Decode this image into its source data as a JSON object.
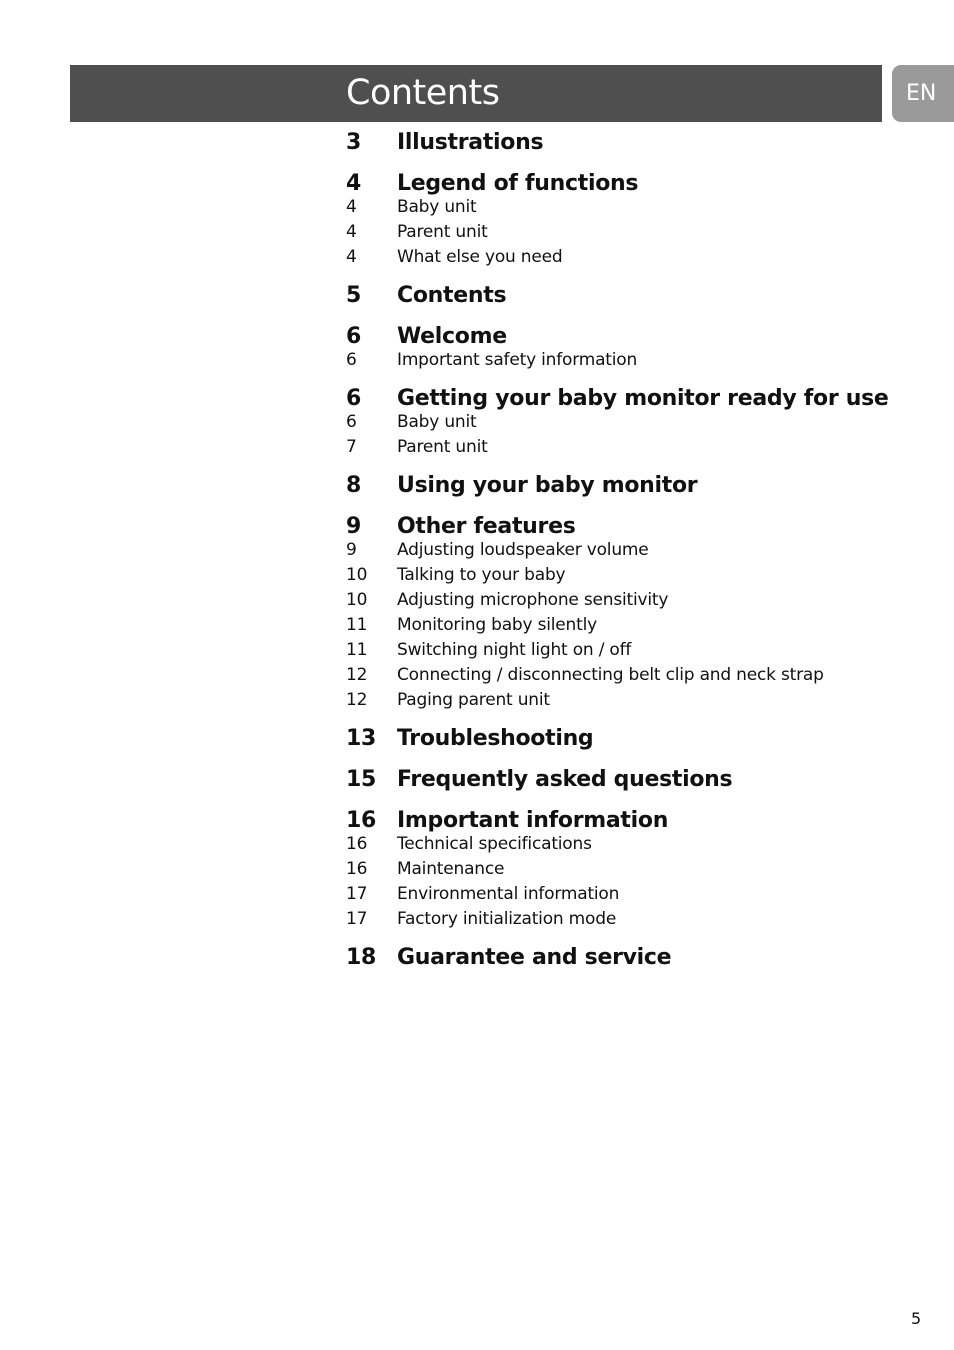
{
  "header": {
    "title": "Contents",
    "language_tab": "EN"
  },
  "colors": {
    "header_bar": "#4f4f4f",
    "language_tab": "#9a9a9a",
    "text": "#111111"
  },
  "toc": [
    {
      "page": "3",
      "title": "Illustrations",
      "subs": []
    },
    {
      "page": "4",
      "title": "Legend of functions",
      "subs": [
        {
          "page": "4",
          "title": "Baby unit"
        },
        {
          "page": "4",
          "title": "Parent unit"
        },
        {
          "page": "4",
          "title": "What else you need"
        }
      ]
    },
    {
      "page": "5",
      "title": "Contents",
      "subs": []
    },
    {
      "page": "6",
      "title": "Welcome",
      "subs": [
        {
          "page": "6",
          "title": "Important safety information"
        }
      ]
    },
    {
      "page": "6",
      "title": "Getting your baby monitor ready for use",
      "subs": [
        {
          "page": "6",
          "title": "Baby unit"
        },
        {
          "page": "7",
          "title": "Parent unit"
        }
      ]
    },
    {
      "page": "8",
      "title": "Using your baby monitor",
      "subs": []
    },
    {
      "page": "9",
      "title": "Other features",
      "subs": [
        {
          "page": "9",
          "title": "Adjusting loudspeaker volume"
        },
        {
          "page": "10",
          "title": "Talking to your baby"
        },
        {
          "page": "10",
          "title": "Adjusting microphone sensitivity"
        },
        {
          "page": "11",
          "title": "Monitoring baby silently"
        },
        {
          "page": "11",
          "title": "Switching night light on / off"
        },
        {
          "page": "12",
          "title": "Connecting / disconnecting belt clip and neck strap"
        },
        {
          "page": "12",
          "title": "Paging parent unit"
        }
      ]
    },
    {
      "page": "13",
      "title": "Troubleshooting",
      "subs": []
    },
    {
      "page": "15",
      "title": "Frequently asked questions",
      "subs": []
    },
    {
      "page": "16",
      "title": "Important information",
      "subs": [
        {
          "page": "16",
          "title": "Technical specifications"
        },
        {
          "page": "16",
          "title": "Maintenance"
        },
        {
          "page": "17",
          "title": "Environmental information"
        },
        {
          "page": "17",
          "title": "Factory initialization mode"
        }
      ]
    },
    {
      "page": "18",
      "title": "Guarantee and service",
      "subs": []
    }
  ],
  "footer": {
    "page_number": "5"
  }
}
